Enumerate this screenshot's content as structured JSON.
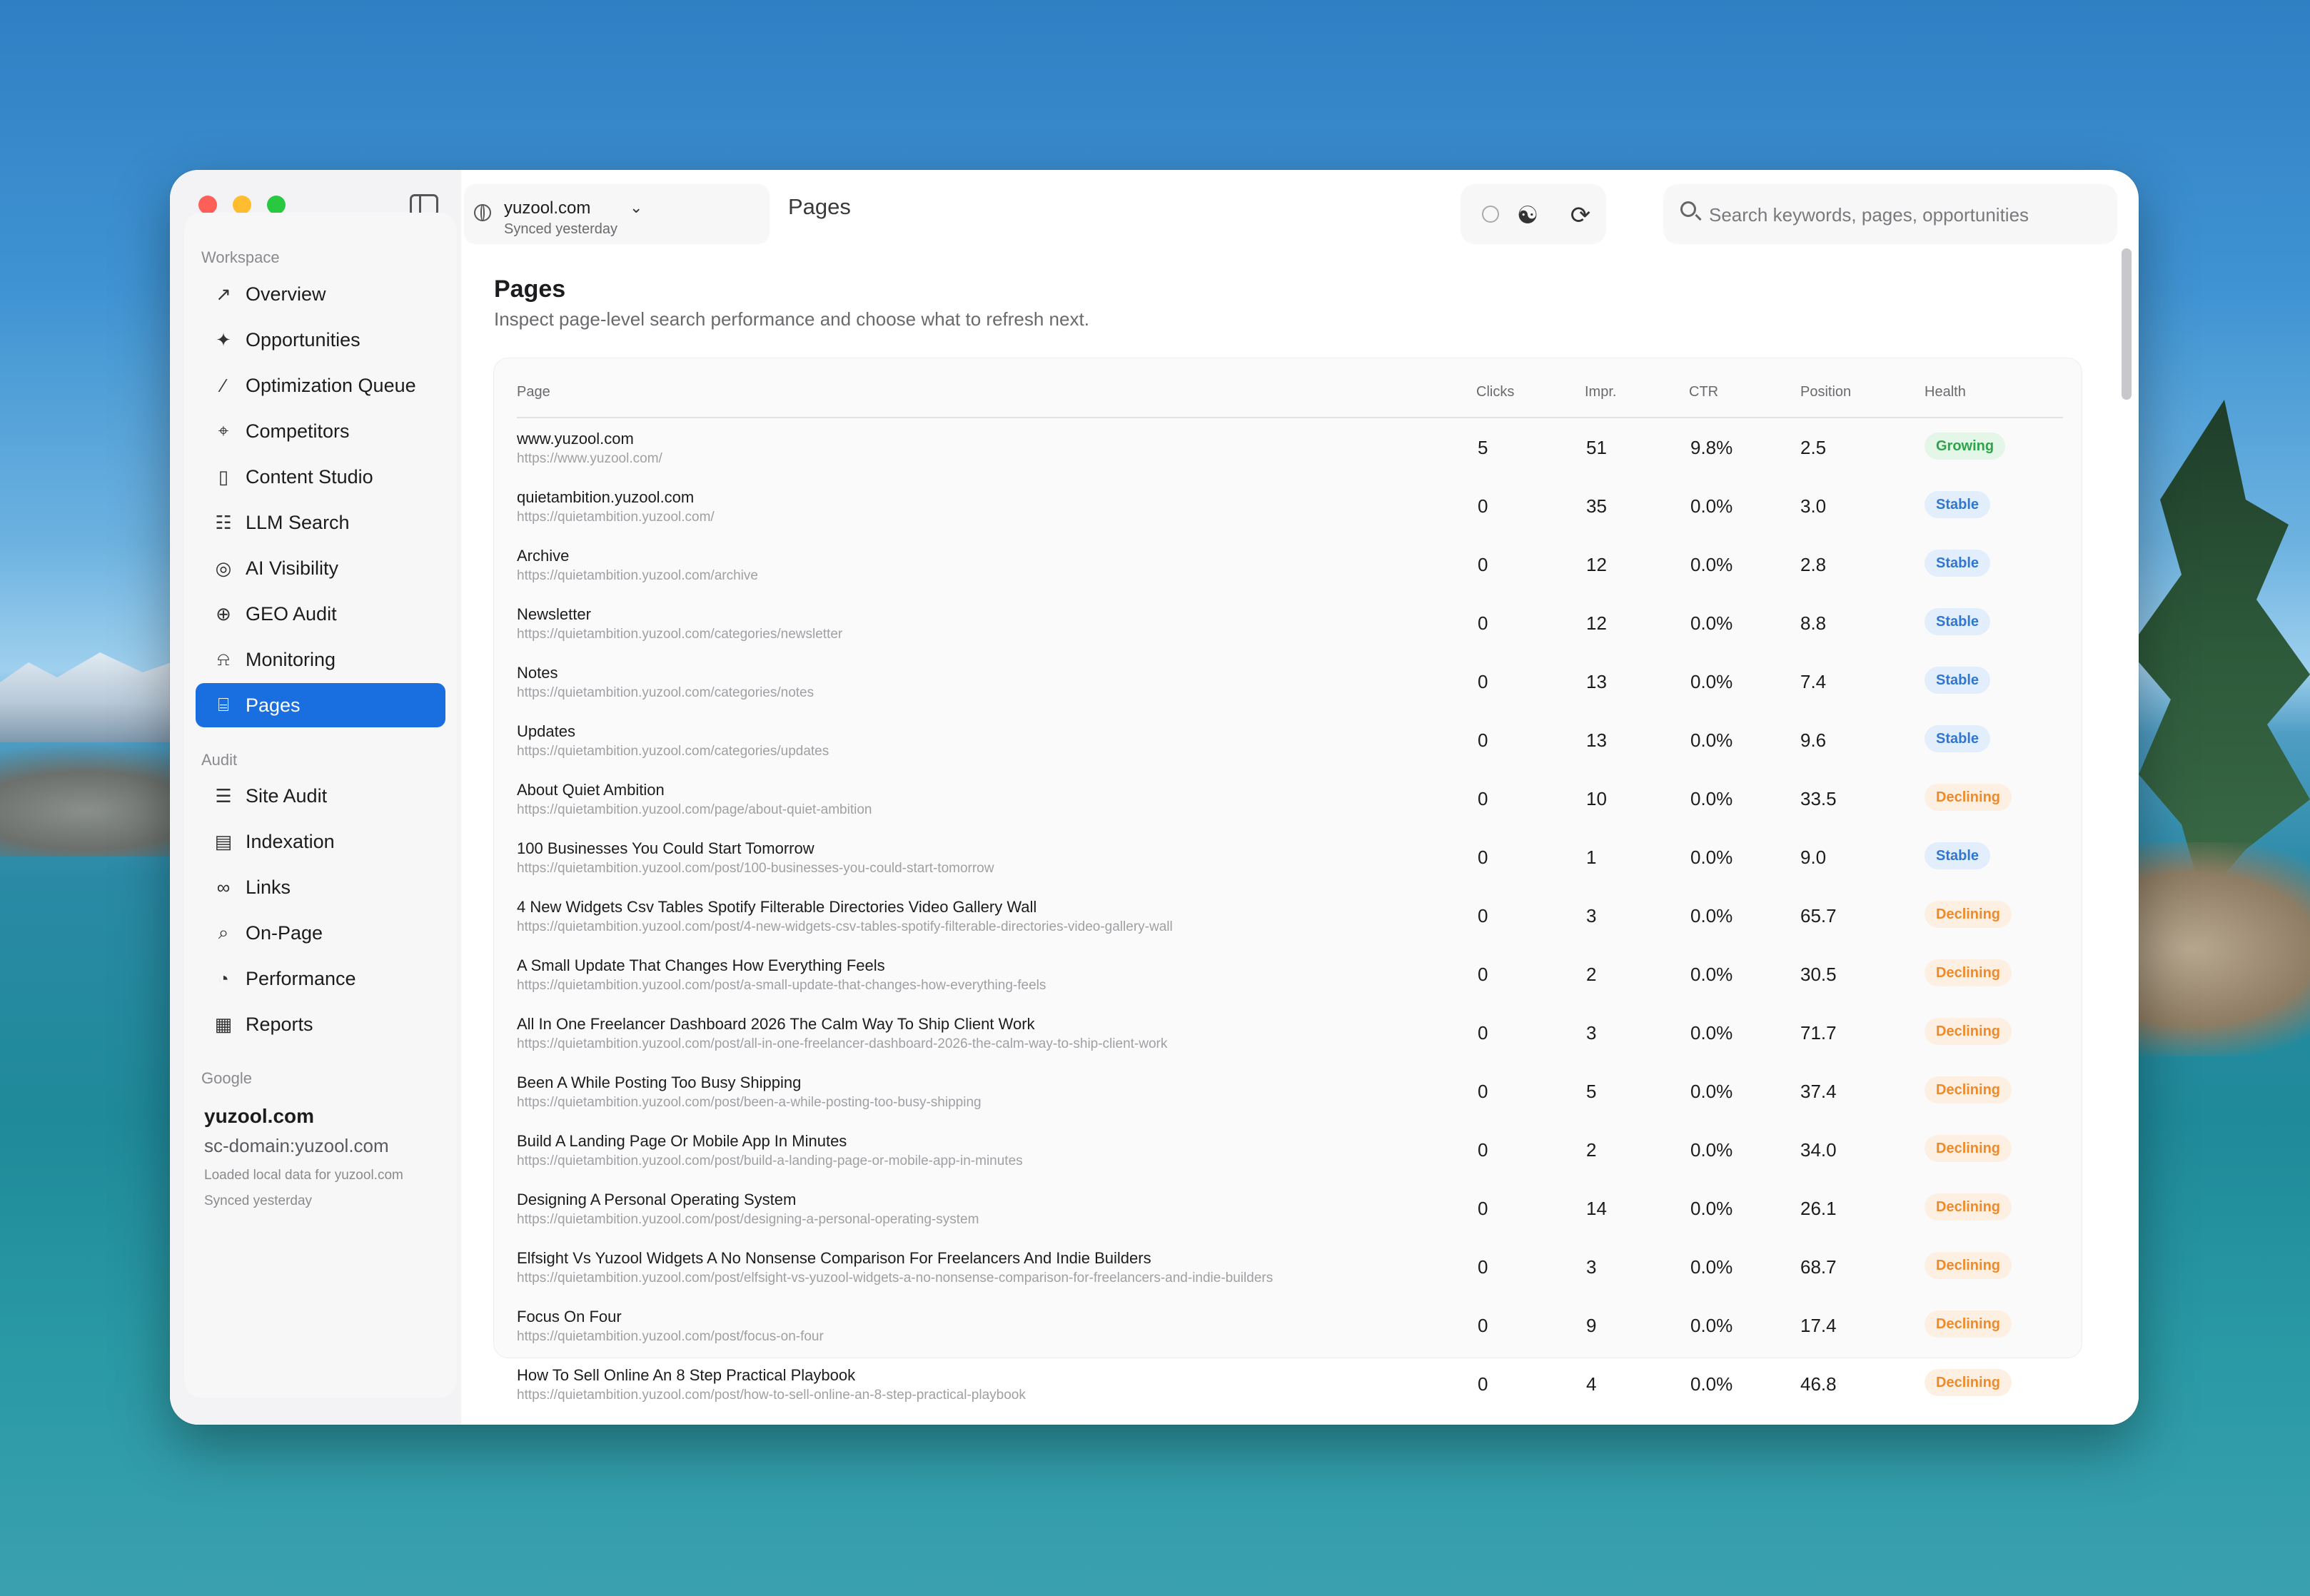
{
  "window": {
    "site": "yuzool.com",
    "site_status": "Synced yesterday",
    "header_title": "Pages",
    "search_placeholder": "Search keywords, pages, opportunities"
  },
  "sidebar": {
    "workspace_label": "Workspace",
    "workspace_items": [
      {
        "label": "Overview",
        "icon": "chart-line-icon"
      },
      {
        "label": "Opportunities",
        "icon": "sparkles-icon"
      },
      {
        "label": "Optimization Queue",
        "icon": "wand-icon"
      },
      {
        "label": "Competitors",
        "icon": "crosshair-icon"
      },
      {
        "label": "Content Studio",
        "icon": "document-icon"
      },
      {
        "label": "LLM Search",
        "icon": "chat-bubbles-icon"
      },
      {
        "label": "AI Visibility",
        "icon": "target-icon"
      },
      {
        "label": "GEO Audit",
        "icon": "magnifier-plus-icon"
      },
      {
        "label": "Monitoring",
        "icon": "bell-icon"
      },
      {
        "label": "Pages",
        "icon": "page-search-icon"
      }
    ],
    "audit_label": "Audit",
    "audit_items": [
      {
        "label": "Site Audit",
        "icon": "checklist-icon"
      },
      {
        "label": "Indexation",
        "icon": "map-icon"
      },
      {
        "label": "Links",
        "icon": "link-icon"
      },
      {
        "label": "On-Page",
        "icon": "magnifier-icon"
      },
      {
        "label": "Performance",
        "icon": "gauge-icon"
      },
      {
        "label": "Reports",
        "icon": "report-icon"
      }
    ],
    "google_label": "Google",
    "google": {
      "domain": "yuzool.com",
      "property": "sc-domain:yuzool.com",
      "loaded": "Loaded local data for yuzool.com",
      "synced": "Synced yesterday"
    }
  },
  "page": {
    "title": "Pages",
    "subtitle": "Inspect page-level search performance and choose what to refresh next."
  },
  "table": {
    "headers": {
      "page": "Page",
      "clicks": "Clicks",
      "impr": "Impr.",
      "ctr": "CTR",
      "position": "Position",
      "health": "Health"
    },
    "rows": [
      {
        "title": "www.yuzool.com",
        "url": "https://www.yuzool.com/",
        "clicks": "5",
        "impr": "51",
        "ctr": "9.8%",
        "position": "2.5",
        "health": "Growing"
      },
      {
        "title": "quietambition.yuzool.com",
        "url": "https://quietambition.yuzool.com/",
        "clicks": "0",
        "impr": "35",
        "ctr": "0.0%",
        "position": "3.0",
        "health": "Stable"
      },
      {
        "title": "Archive",
        "url": "https://quietambition.yuzool.com/archive",
        "clicks": "0",
        "impr": "12",
        "ctr": "0.0%",
        "position": "2.8",
        "health": "Stable"
      },
      {
        "title": "Newsletter",
        "url": "https://quietambition.yuzool.com/categories/newsletter",
        "clicks": "0",
        "impr": "12",
        "ctr": "0.0%",
        "position": "8.8",
        "health": "Stable"
      },
      {
        "title": "Notes",
        "url": "https://quietambition.yuzool.com/categories/notes",
        "clicks": "0",
        "impr": "13",
        "ctr": "0.0%",
        "position": "7.4",
        "health": "Stable"
      },
      {
        "title": "Updates",
        "url": "https://quietambition.yuzool.com/categories/updates",
        "clicks": "0",
        "impr": "13",
        "ctr": "0.0%",
        "position": "9.6",
        "health": "Stable"
      },
      {
        "title": "About Quiet Ambition",
        "url": "https://quietambition.yuzool.com/page/about-quiet-ambition",
        "clicks": "0",
        "impr": "10",
        "ctr": "0.0%",
        "position": "33.5",
        "health": "Declining"
      },
      {
        "title": "100 Businesses You Could Start Tomorrow",
        "url": "https://quietambition.yuzool.com/post/100-businesses-you-could-start-tomorrow",
        "clicks": "0",
        "impr": "1",
        "ctr": "0.0%",
        "position": "9.0",
        "health": "Stable"
      },
      {
        "title": "4 New Widgets Csv Tables Spotify Filterable Directories Video Gallery Wall",
        "url": "https://quietambition.yuzool.com/post/4-new-widgets-csv-tables-spotify-filterable-directories-video-gallery-wall",
        "clicks": "0",
        "impr": "3",
        "ctr": "0.0%",
        "position": "65.7",
        "health": "Declining"
      },
      {
        "title": "A Small Update That Changes How Everything Feels",
        "url": "https://quietambition.yuzool.com/post/a-small-update-that-changes-how-everything-feels",
        "clicks": "0",
        "impr": "2",
        "ctr": "0.0%",
        "position": "30.5",
        "health": "Declining"
      },
      {
        "title": "All In One Freelancer Dashboard 2026 The Calm Way To Ship Client Work",
        "url": "https://quietambition.yuzool.com/post/all-in-one-freelancer-dashboard-2026-the-calm-way-to-ship-client-work",
        "clicks": "0",
        "impr": "3",
        "ctr": "0.0%",
        "position": "71.7",
        "health": "Declining"
      },
      {
        "title": "Been A While Posting Too Busy Shipping",
        "url": "https://quietambition.yuzool.com/post/been-a-while-posting-too-busy-shipping",
        "clicks": "0",
        "impr": "5",
        "ctr": "0.0%",
        "position": "37.4",
        "health": "Declining"
      },
      {
        "title": "Build A Landing Page Or Mobile App In Minutes",
        "url": "https://quietambition.yuzool.com/post/build-a-landing-page-or-mobile-app-in-minutes",
        "clicks": "0",
        "impr": "2",
        "ctr": "0.0%",
        "position": "34.0",
        "health": "Declining"
      },
      {
        "title": "Designing A Personal Operating System",
        "url": "https://quietambition.yuzool.com/post/designing-a-personal-operating-system",
        "clicks": "0",
        "impr": "14",
        "ctr": "0.0%",
        "position": "26.1",
        "health": "Declining"
      },
      {
        "title": "Elfsight Vs Yuzool Widgets A No Nonsense Comparison For Freelancers And Indie Builders",
        "url": "https://quietambition.yuzool.com/post/elfsight-vs-yuzool-widgets-a-no-nonsense-comparison-for-freelancers-and-indie-builders",
        "clicks": "0",
        "impr": "3",
        "ctr": "0.0%",
        "position": "68.7",
        "health": "Declining"
      },
      {
        "title": "Focus On Four",
        "url": "https://quietambition.yuzool.com/post/focus-on-four",
        "clicks": "0",
        "impr": "9",
        "ctr": "0.0%",
        "position": "17.4",
        "health": "Declining"
      },
      {
        "title": "How To Sell Online An 8 Step Practical Playbook",
        "url": "https://quietambition.yuzool.com/post/how-to-sell-online-an-8-step-practical-playbook",
        "clicks": "0",
        "impr": "4",
        "ctr": "0.0%",
        "position": "46.8",
        "health": "Declining"
      }
    ]
  },
  "colors": {
    "accent": "#1a6fe0",
    "growing": "#2fa24a",
    "stable": "#2f77d2",
    "declining": "#ee8a2a"
  }
}
